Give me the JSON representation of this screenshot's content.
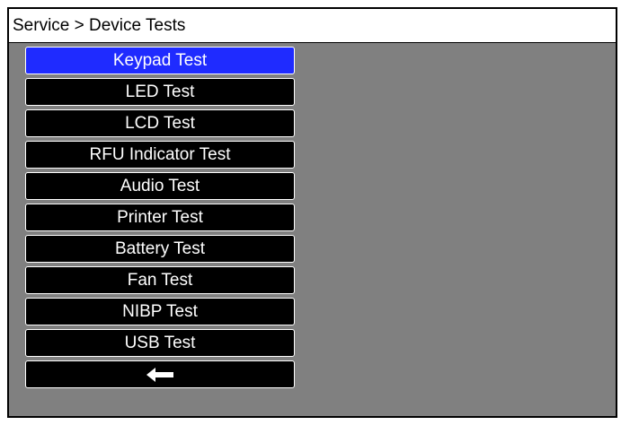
{
  "header": {
    "breadcrumb": "Service > Device Tests"
  },
  "menu": {
    "items": [
      {
        "label": "Keypad Test",
        "selected": true
      },
      {
        "label": "LED Test",
        "selected": false
      },
      {
        "label": "LCD Test",
        "selected": false
      },
      {
        "label": "RFU Indicator Test",
        "selected": false
      },
      {
        "label": "Audio Test",
        "selected": false
      },
      {
        "label": "Printer Test",
        "selected": false
      },
      {
        "label": "Battery Test",
        "selected": false
      },
      {
        "label": "Fan Test",
        "selected": false
      },
      {
        "label": "NIBP Test",
        "selected": false
      },
      {
        "label": "USB Test",
        "selected": false
      }
    ],
    "back_icon": "left-arrow-icon"
  },
  "colors": {
    "selected": "#1f2bff",
    "button": "#000000",
    "background": "#808080",
    "header": "#ffffff"
  }
}
